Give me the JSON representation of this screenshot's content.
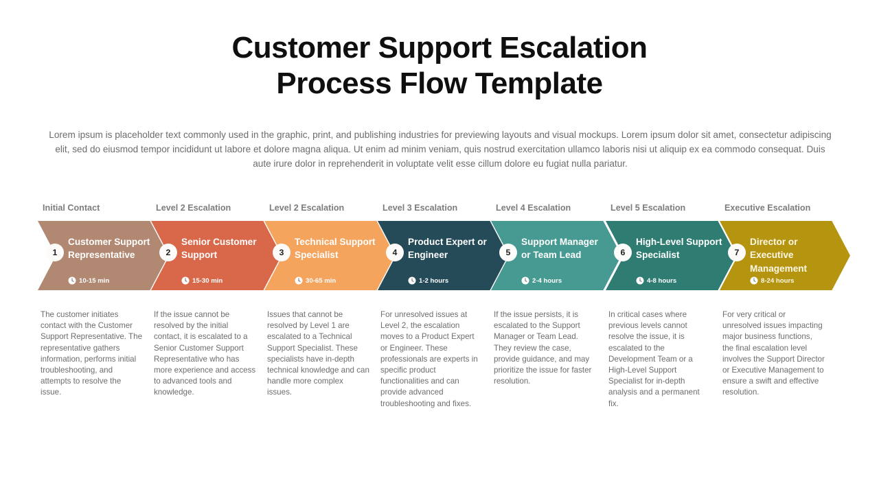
{
  "title": {
    "line1": "Customer Support Escalation",
    "line2": "Process Flow Template"
  },
  "intro": "Lorem ipsum is placeholder text commonly used in the graphic, print, and publishing industries for previewing layouts and visual mockups. Lorem ipsum dolor sit amet, consectetur adipiscing elit, sed do eiusmod tempor incididunt ut labore et dolore magna aliqua. Ut enim ad minim veniam, quis nostrud exercitation ullamco laboris nisi ut aliquip ex ea commodo consequat. Duis aute irure dolor in reprehenderit in voluptate velit esse cillum dolore eu fugiat nulla pariatur.",
  "stages": [
    {
      "number": "1",
      "header": "Initial Contact",
      "role": "Customer Support Representative",
      "time": "10-15 min",
      "color": "#b18872",
      "role_color": "#ffffff",
      "description": "The customer initiates contact with the Customer Support Representative. The representative gathers information, performs initial troubleshooting, and attempts to resolve the issue."
    },
    {
      "number": "2",
      "header": "Level 2 Escalation",
      "role": "Senior Customer Support",
      "time": "15-30 min",
      "color": "#d9684b",
      "role_color": "#ffffff",
      "description": "If the issue cannot be resolved by the initial contact, it is escalated to a Senior Customer Support Representative who has more experience and access to advanced tools and knowledge."
    },
    {
      "number": "3",
      "header": "Level 2 Escalation",
      "role": "Technical Support Specialist",
      "time": "30-65 min",
      "color": "#f5a45e",
      "role_color": "#ffffff",
      "description": "Issues that cannot be resolved by Level 1 are escalated to a Technical Support Specialist. These specialists have in-depth technical knowledge and can handle more complex issues."
    },
    {
      "number": "4",
      "header": "Level 3 Escalation",
      "role": "Product Expert or Engineer",
      "time": "1-2 hours",
      "color": "#254a58",
      "role_color": "#ffffff",
      "description": "For unresolved issues at Level 2, the escalation moves to a Product Expert or Engineer. These professionals are experts in specific product functionalities and can provide advanced troubleshooting and fixes."
    },
    {
      "number": "5",
      "header": "Level 4 Escalation",
      "role": "Support Manager or Team Lead",
      "time": "2-4 hours",
      "color": "#469a92",
      "role_color": "#ffffff",
      "description": "If the issue persists, it is escalated to the Support Manager or Team Lead. They review the case, provide guidance, and may prioritize the issue for faster resolution."
    },
    {
      "number": "6",
      "header": "Level 5 Escalation",
      "role": "High-Level Support Specialist",
      "time": "4-8 hours",
      "color": "#2f7d72",
      "role_color": "#ffffff",
      "description": "In critical cases where previous levels cannot resolve the issue, it is escalated to the Development Team or a High-Level Support Specialist for in-depth analysis and a permanent fix."
    },
    {
      "number": "7",
      "header": "Executive Escalation",
      "role": "Director or Executive Management",
      "time": "8-24 hours",
      "color": "#b59410",
      "role_color": "#fdf8e6",
      "description": "For very critical or unresolved issues impacting major business functions, the final escalation level involves the Support Director or Executive Management to ensure a swift and effective resolution."
    }
  ]
}
